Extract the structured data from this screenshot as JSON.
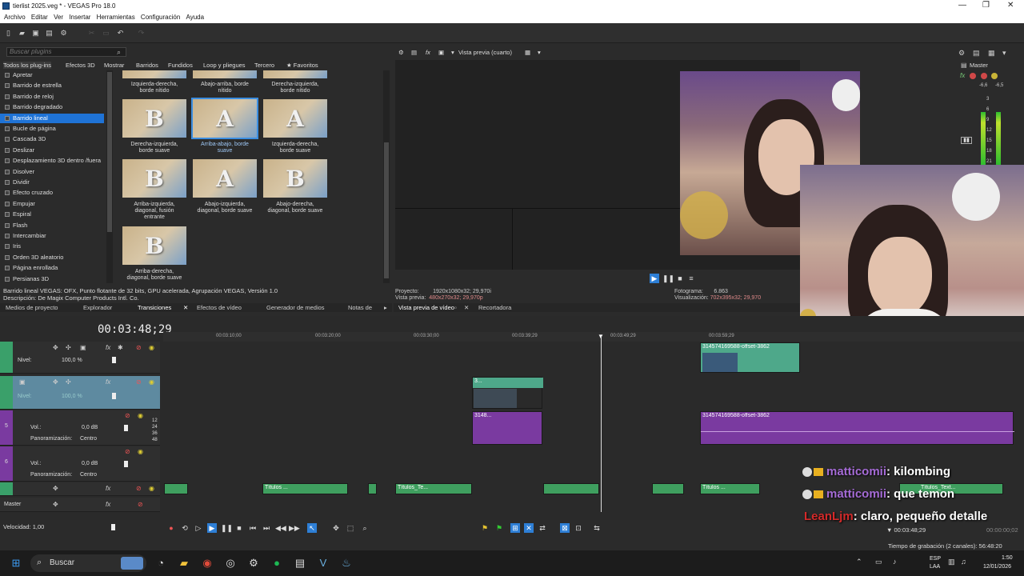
{
  "window": {
    "title": "tierlist 2025.veg * - VEGAS Pro 18.0",
    "controls": [
      "—",
      "❐",
      "✕"
    ]
  },
  "menu": [
    "Archivo",
    "Editar",
    "Ver",
    "Insertar",
    "Herramientas",
    "Configuración",
    "Ayuda"
  ],
  "plugins": {
    "search_placeholder": "Buscar plugins",
    "filter_tabs": [
      "Todos los plug-ins",
      "Efectos 3D",
      "Mostrar",
      "Barridos",
      "Fundidos",
      "Loop y pliegues",
      "Tercero",
      "★ Favoritos"
    ],
    "list": [
      "Apretar",
      "Barrido de estrella",
      "Barrido de reloj",
      "Barrido degradado",
      "Barrido lineal",
      "Bucle de página",
      "Cascada 3D",
      "Deslizar",
      "Desplazamiento 3D dentro /fuera",
      "Disolver",
      "Dividir",
      "Efecto cruzado",
      "Empujar",
      "Espiral",
      "Flash",
      "Intercambiar",
      "Iris",
      "Orden 3D aleatorio",
      "Página enrollada",
      "Persianas 3D"
    ],
    "selected_index": 4,
    "top_labels": [
      {
        "l1": "Izquierda-derecha,",
        "l2": "borde nítido"
      },
      {
        "l1": "Abajo-arriba, borde",
        "l2": "nítido"
      },
      {
        "l1": "Derecha-izquierda,",
        "l2": "borde nítido"
      }
    ],
    "presets": [
      {
        "letter": "B",
        "l1": "Derecha-izquierda,",
        "l2": "borde suave",
        "l3": ""
      },
      {
        "letter": "A",
        "l1": "Arriba-abajo, borde",
        "l2": "suave",
        "l3": ""
      },
      {
        "letter": "A",
        "l1": "Izquierda-derecha,",
        "l2": "borde suave",
        "l3": ""
      },
      {
        "letter": "B",
        "l1": "Arriba-izquierda,",
        "l2": "diagonal, fusión",
        "l3": "entrante"
      },
      {
        "letter": "A",
        "l1": "Abajo-izquierda,",
        "l2": "diagonal, borde suave",
        "l3": ""
      },
      {
        "letter": "B",
        "l1": "Abajo-derecha,",
        "l2": "diagonal, borde suave",
        "l3": ""
      },
      {
        "letter": "B",
        "l1": "Arriba-derecha,",
        "l2": "diagonal, borde suave",
        "l3": ""
      }
    ],
    "selected_preset": 1,
    "desc_line1": "Barrido lineal VEGAS: OFX, Punto flotante de 32 bits, GPU acelerada, Agrupación VEGAS, Versión 1.0",
    "desc_line2": "Descripción: De Magix Computer Products Intl. Co.",
    "bottom_tabs": [
      "Medios de proyecto",
      "Explorador",
      "Transiciones",
      "Efectos de vídeo",
      "Generador de medios",
      "Notas de"
    ]
  },
  "preview": {
    "mode": "Vista previa (cuarto)",
    "project_label": "Proyecto:",
    "project_value": "1920x1080x32; 29,970i",
    "preview_label": "Vista previa:",
    "preview_value": "480x270x32; 29,970p",
    "frame_label": "Fotograma:",
    "frame_value": "6.863",
    "display_label": "Visualización:",
    "display_value": "702x395x32; 29,970",
    "tabs": [
      "Vista previa de vídeo",
      "Recortadora"
    ]
  },
  "master": {
    "label": "Master",
    "peak_left": "-6,6",
    "peak_right": "-6,5",
    "scale": [
      "3",
      "6",
      "9",
      "12",
      "15",
      "18",
      "21"
    ]
  },
  "timeline": {
    "timecode": "00:03:48;29",
    "ruler": [
      "00:03:10;00",
      "00:03:20;00",
      "00:03:30;00",
      "00:03:39;29",
      "00:03:49;29",
      "00:03:59;29"
    ],
    "track1": {
      "level_label": "Nivel:",
      "level_value": "100,0 %"
    },
    "track2": {
      "level_label": "Nivel:",
      "level_value": "100,0 %"
    },
    "track3": {
      "vol_label": "Vol.:",
      "vol_value": "0,0 dB",
      "pan_label": "Panoramización:",
      "pan_value": "Centro",
      "num": "5"
    },
    "track4": {
      "vol_label": "Vol.:",
      "vol_value": "0,0 dB",
      "pan_label": "Panoramización:",
      "pan_value": "Centro",
      "num": "6"
    },
    "db_scale": [
      "12",
      "24",
      "36",
      "48"
    ],
    "master_label": "Master",
    "velocity_label": "Velocidad: 1,00",
    "clip_video_top": "314574169588-offset-3862",
    "clip_audio_right": "314574169588-offset-3862",
    "clip_small_v": "3...",
    "clip_small_a": "3148...",
    "title_clips": [
      "Títulos ...",
      "Títulos_Te...",
      "Títulos ...",
      "Títulos_Text..."
    ],
    "position": "00:03:48;29",
    "position2": "00:00:00;02",
    "status": "Tiempo de grabación (2 canales): 56:48:20"
  },
  "chat": [
    {
      "user": "matticomii",
      "text": ": kilombing",
      "color": "purple"
    },
    {
      "user": "matticomii",
      "text": ": que temon",
      "color": "purple"
    },
    {
      "user": "LeanLjm",
      "text": ": claro, pequeño detalle",
      "color": "red"
    }
  ],
  "taskbar": {
    "search": "Buscar",
    "lang1": "ESP",
    "lang2": "LAA",
    "time": "1:50",
    "date": "12/01/2026"
  }
}
